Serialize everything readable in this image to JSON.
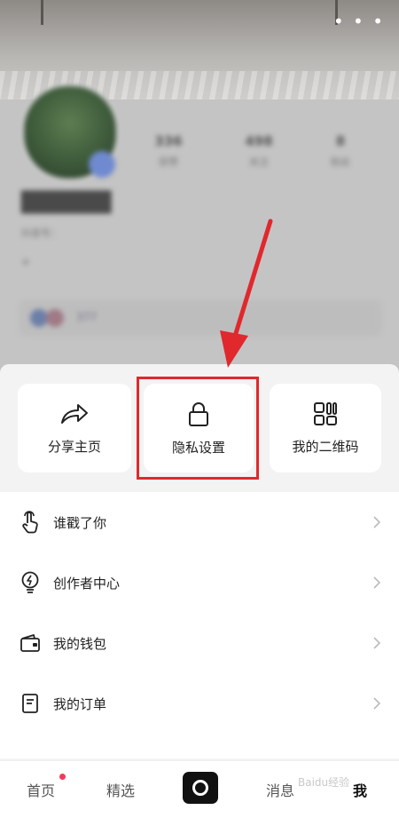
{
  "header": {
    "more_icon": "more-dots-icon"
  },
  "profile": {
    "nickname": "██████",
    "account_id": "抖音号：",
    "stats": [
      {
        "num": "336",
        "label": "获赞"
      },
      {
        "num": "498",
        "label": "关注"
      },
      {
        "num": "8",
        "label": "粉丝"
      }
    ],
    "tag": "+ ",
    "friends_text": "377 ",
    "bio": ""
  },
  "actions": [
    {
      "label": "分享主页",
      "icon": "share-icon"
    },
    {
      "label": "隐私设置",
      "icon": "lock-icon"
    },
    {
      "label": "我的二维码",
      "icon": "qrcode-icon"
    }
  ],
  "menu": [
    {
      "label": "谁戳了你",
      "icon": "poke-hand-icon"
    },
    {
      "label": "创作者中心",
      "icon": "bulb-icon"
    },
    {
      "label": "我的钱包",
      "icon": "wallet-icon"
    },
    {
      "label": "我的订单",
      "icon": "order-icon"
    }
  ],
  "tabbar": {
    "home": "首页",
    "featured": "精选",
    "messages": "消息",
    "me": "我"
  },
  "annotation": {
    "highlight_color": "#e0282d"
  },
  "watermark": "Baidu经验"
}
